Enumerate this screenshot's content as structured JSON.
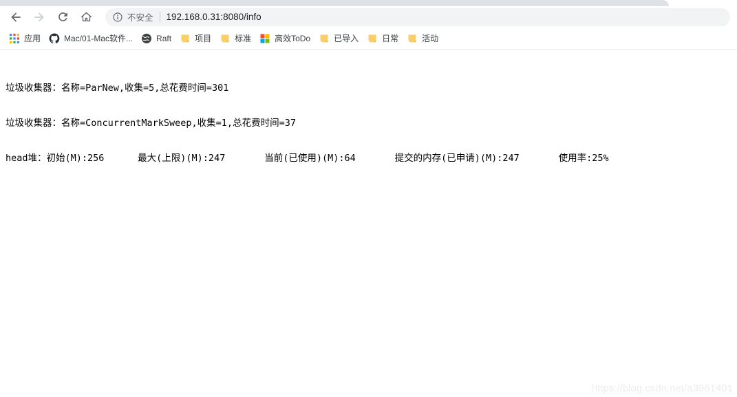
{
  "browser": {
    "nav": {
      "back_label": "Back",
      "forward_label": "Forward",
      "reload_label": "Reload",
      "home_label": "Home"
    },
    "omnibox": {
      "security_label": "不安全",
      "url": "192.168.0.31:8080/info",
      "info_icon": "info-circle-icon"
    },
    "bookmarks": [
      {
        "icon": "apps-grid-icon",
        "label": "应用"
      },
      {
        "icon": "github-icon",
        "label": "Mac/01-Mac软件..."
      },
      {
        "icon": "globe-dark-icon",
        "label": "Raft"
      },
      {
        "icon": "folder-icon",
        "label": "项目"
      },
      {
        "icon": "folder-icon",
        "label": "标准"
      },
      {
        "icon": "microsoft-logo-icon",
        "label": "高效ToDo"
      },
      {
        "icon": "folder-icon",
        "label": "已导入"
      },
      {
        "icon": "folder-icon",
        "label": "日常"
      },
      {
        "icon": "folder-icon",
        "label": "活动"
      }
    ]
  },
  "page": {
    "lines": [
      "垃圾收集器：名称=ParNew,收集=5,总花费时间=301",
      "垃圾收集器：名称=ConcurrentMarkSweep,收集=1,总花费时间=37",
      "head堆：初始(M):256      最大(上限)(M):247       当前(已使用)(M):64       提交的内存(已申请)(M):247       使用率:25%"
    ],
    "gc_collectors": [
      {
        "name": "ParNew",
        "collections": 5,
        "total_time_ms": 301
      },
      {
        "name": "ConcurrentMarkSweep",
        "collections": 1,
        "total_time_ms": 37
      }
    ],
    "heap": {
      "initial_mb": 256,
      "max_mb": 247,
      "used_mb": 64,
      "committed_mb": 247,
      "usage_percent": "25%"
    },
    "watermark": "https://blog.csdn.net/a3961401"
  },
  "colors": {
    "tabstrip": "#dee1e6",
    "omnibox_bg": "#f1f3f4",
    "text": "#202124",
    "muted": "#5f6368",
    "folder": "#f7c75b",
    "ms_red": "#f25022",
    "ms_green": "#7fba00",
    "ms_blue": "#00a4ef",
    "ms_yellow": "#ffb900"
  }
}
